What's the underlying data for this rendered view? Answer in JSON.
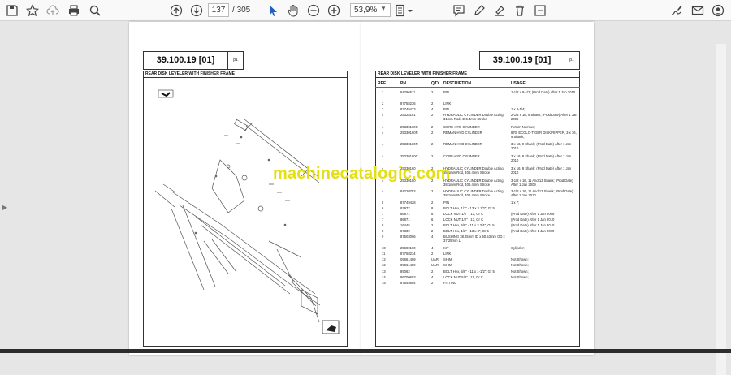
{
  "toolbar": {
    "page_current": "137",
    "page_separator": "/",
    "page_total": "305",
    "zoom": "53,9%",
    "icons": [
      "save-icon",
      "bookmark-star-icon",
      "upload-cloud-icon",
      "print-icon",
      "zoom-search-icon",
      "prev-page-icon",
      "next-page-icon",
      "select-cursor-icon",
      "hand-pan-icon",
      "zoom-out-icon",
      "zoom-in-icon",
      "page-fit-icon",
      "comment-icon",
      "pen-icon",
      "highlight-icon",
      "delete-icon",
      "more-icon",
      "sign-icon",
      "mail-icon",
      "account-icon"
    ]
  },
  "document": {
    "section": "39.100.19 [01]",
    "page_label": "p1",
    "title": "REAR DISK LEVELER WITH FINISHER FRAME",
    "columns": {
      "ref": "REF",
      "pn": "PN",
      "qty": "QTY",
      "description": "DESCRIPTION",
      "usage": "USAGE"
    },
    "rows": [
      {
        "ref": "1",
        "pn": "84296511",
        "qty": "2",
        "desc": "PIN",
        "usage": "1-1/2 x 8-1/2; (Prod Date) After 1 Jan 2010"
      },
      {
        "ref": "2",
        "pn": "87758236",
        "qty": "2",
        "desc": "LINK",
        "usage": ""
      },
      {
        "ref": "3",
        "pn": "87749423",
        "qty": "4",
        "desc": "PIN",
        "usage": "1 x 8-1/4;"
      },
      {
        "ref": "4",
        "pn": "25328161",
        "qty": "2",
        "desc": "HYDRAULIC CYLINDER Double Acting, 31mm Rod, 406.4mm Stroke",
        "usage": "2-1/2 x 16, 9 Shank; (Prod Date) After 1 Jan 2005"
      },
      {
        "ref": "4",
        "pn": "25330160C",
        "qty": "2",
        "desc": "CORE-HYD CYLINDER",
        "usage": "Return Number;"
      },
      {
        "ref": "4",
        "pn": "25330160R",
        "qty": "2",
        "desc": "REMAN-HYD CYLINDER",
        "usage": "870, ECOLO-TIGER DISK RIPPER, 3 x 16, 9 Shank;"
      },
      {
        "ref": "4",
        "pn": "25330160R",
        "qty": "2",
        "desc": "REMAN-HYD CYLINDER",
        "usage": "3 x 16, 9 Shank; (Prod Date) After 1 Jan 2010"
      },
      {
        "ref": "4",
        "pn": "25330160C",
        "qty": "2",
        "desc": "CORE-HYD CYLINDER",
        "usage": "3 x 16, 9 Shank; (Prod Date) After 1 Jan 2010"
      },
      {
        "ref": "4",
        "pn": "25330160",
        "qty": "2",
        "desc": "HYDRAULIC CYLINDER Double Acting, 38.1mm Rod, 406.4mm Stroke",
        "usage": "3 x 16, 9 Shank; (Prod Date) After 1 Jan 2010"
      },
      {
        "ref": "4",
        "pn": "25330150",
        "qty": "2",
        "desc": "HYDRAULIC CYLINDER Double Acting, 38.1mm Rod, 406.4mm Stroke",
        "usage": "3-1/2 x 16, 11 And 13 Shank; (Prod Date) After 1 Jan 2009"
      },
      {
        "ref": "4",
        "pn": "84220783",
        "qty": "2",
        "desc": "HYDRAULIC CYLINDER Double Acting, 38.1mm Rod, 406.4mm Stroke",
        "usage": "3-1/2 x 16, 11 And 13 Shank; (Prod Date) After 1 Jan 2010"
      },
      {
        "ref": "5",
        "pn": "87749428",
        "qty": "2",
        "desc": "PIN",
        "usage": "1 x 7;"
      },
      {
        "ref": "6",
        "pn": "87972",
        "qty": "8",
        "desc": "BOLT Hex, 1/2\" - 13 x 2 1/2\", Gr 5",
        "usage": ""
      },
      {
        "ref": "7",
        "pn": "86871",
        "qty": "8",
        "desc": "LOCK NUT 1/2\" - 13, Gr C",
        "usage": "(Prod Date) After 1 Jan 2009"
      },
      {
        "ref": "7",
        "pn": "86871",
        "qty": "6",
        "desc": "LOCK NUT 1/2\" - 13, Gr C",
        "usage": "(Prod Date) After 1 Jan 2010"
      },
      {
        "ref": "8",
        "pn": "16445",
        "qty": "2",
        "desc": "BOLT Hex, 5/8\" - 11 x 3 3/4\", Gr 5",
        "usage": "(Prod Date) After 1 Jan 2010"
      },
      {
        "ref": "8",
        "pn": "87339",
        "qty": "2",
        "desc": "BOLT Hex, 1/2\" - 13 x 3\", Gr 5",
        "usage": "(Prod Date) After 1 Jan 2009"
      },
      {
        "ref": "9",
        "pn": "87503066",
        "qty": "4",
        "desc": "BUSHING 38.25mm ID x 50.53mm OD x 37.25mm L",
        "usage": ""
      },
      {
        "ref": "10",
        "pn": "25690100",
        "qty": "4",
        "desc": "KIT",
        "usage": "Cylinder;"
      },
      {
        "ref": "11",
        "pn": "87758234",
        "qty": "2",
        "desc": "LINK",
        "usage": ""
      },
      {
        "ref": "12",
        "pn": "09661469",
        "qty": "UAR",
        "desc": "SHIM",
        "usage": "Not Shown;"
      },
      {
        "ref": "12",
        "pn": "09661459",
        "qty": "UAR",
        "desc": "SHIM",
        "usage": "Not Shown;"
      },
      {
        "ref": "13",
        "pn": "89062",
        "qty": "2",
        "desc": "BOLT Hex, 5/8\" - 11 x 1-1/2\", Gr 5",
        "usage": "Not Shown;"
      },
      {
        "ref": "14",
        "pn": "86700693",
        "qty": "4",
        "desc": "LOCK NUT 5/8\" - 11, Gr C",
        "usage": "Not Shown;"
      },
      {
        "ref": "15",
        "pn": "87645604",
        "qty": "2",
        "desc": "FITTING",
        "usage": ""
      }
    ]
  },
  "watermark": "machinecatalogic.com",
  "colors": {
    "watermark": "#e3df14",
    "toolbar_bg": "#f9f9f9",
    "viewer_bg": "#e6e6e6"
  }
}
